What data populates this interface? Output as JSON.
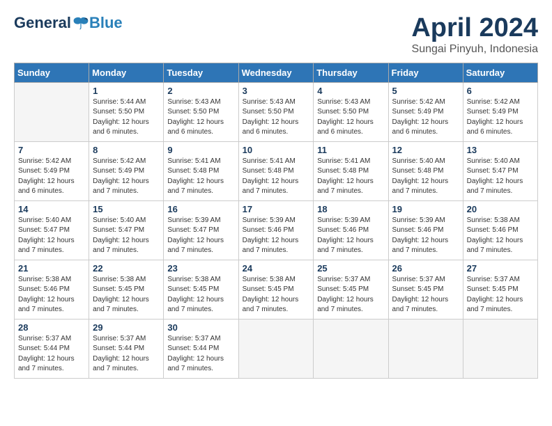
{
  "header": {
    "logo_general": "General",
    "logo_blue": "Blue",
    "month": "April 2024",
    "location": "Sungai Pinyuh, Indonesia"
  },
  "weekdays": [
    "Sunday",
    "Monday",
    "Tuesday",
    "Wednesday",
    "Thursday",
    "Friday",
    "Saturday"
  ],
  "weeks": [
    [
      {
        "day": "",
        "info": ""
      },
      {
        "day": "1",
        "info": "Sunrise: 5:44 AM\nSunset: 5:50 PM\nDaylight: 12 hours\nand 6 minutes."
      },
      {
        "day": "2",
        "info": "Sunrise: 5:43 AM\nSunset: 5:50 PM\nDaylight: 12 hours\nand 6 minutes."
      },
      {
        "day": "3",
        "info": "Sunrise: 5:43 AM\nSunset: 5:50 PM\nDaylight: 12 hours\nand 6 minutes."
      },
      {
        "day": "4",
        "info": "Sunrise: 5:43 AM\nSunset: 5:50 PM\nDaylight: 12 hours\nand 6 minutes."
      },
      {
        "day": "5",
        "info": "Sunrise: 5:42 AM\nSunset: 5:49 PM\nDaylight: 12 hours\nand 6 minutes."
      },
      {
        "day": "6",
        "info": "Sunrise: 5:42 AM\nSunset: 5:49 PM\nDaylight: 12 hours\nand 6 minutes."
      }
    ],
    [
      {
        "day": "7",
        "info": "Sunrise: 5:42 AM\nSunset: 5:49 PM\nDaylight: 12 hours\nand 6 minutes."
      },
      {
        "day": "8",
        "info": "Sunrise: 5:42 AM\nSunset: 5:49 PM\nDaylight: 12 hours\nand 7 minutes."
      },
      {
        "day": "9",
        "info": "Sunrise: 5:41 AM\nSunset: 5:48 PM\nDaylight: 12 hours\nand 7 minutes."
      },
      {
        "day": "10",
        "info": "Sunrise: 5:41 AM\nSunset: 5:48 PM\nDaylight: 12 hours\nand 7 minutes."
      },
      {
        "day": "11",
        "info": "Sunrise: 5:41 AM\nSunset: 5:48 PM\nDaylight: 12 hours\nand 7 minutes."
      },
      {
        "day": "12",
        "info": "Sunrise: 5:40 AM\nSunset: 5:48 PM\nDaylight: 12 hours\nand 7 minutes."
      },
      {
        "day": "13",
        "info": "Sunrise: 5:40 AM\nSunset: 5:47 PM\nDaylight: 12 hours\nand 7 minutes."
      }
    ],
    [
      {
        "day": "14",
        "info": "Sunrise: 5:40 AM\nSunset: 5:47 PM\nDaylight: 12 hours\nand 7 minutes."
      },
      {
        "day": "15",
        "info": "Sunrise: 5:40 AM\nSunset: 5:47 PM\nDaylight: 12 hours\nand 7 minutes."
      },
      {
        "day": "16",
        "info": "Sunrise: 5:39 AM\nSunset: 5:47 PM\nDaylight: 12 hours\nand 7 minutes."
      },
      {
        "day": "17",
        "info": "Sunrise: 5:39 AM\nSunset: 5:46 PM\nDaylight: 12 hours\nand 7 minutes."
      },
      {
        "day": "18",
        "info": "Sunrise: 5:39 AM\nSunset: 5:46 PM\nDaylight: 12 hours\nand 7 minutes."
      },
      {
        "day": "19",
        "info": "Sunrise: 5:39 AM\nSunset: 5:46 PM\nDaylight: 12 hours\nand 7 minutes."
      },
      {
        "day": "20",
        "info": "Sunrise: 5:38 AM\nSunset: 5:46 PM\nDaylight: 12 hours\nand 7 minutes."
      }
    ],
    [
      {
        "day": "21",
        "info": "Sunrise: 5:38 AM\nSunset: 5:46 PM\nDaylight: 12 hours\nand 7 minutes."
      },
      {
        "day": "22",
        "info": "Sunrise: 5:38 AM\nSunset: 5:45 PM\nDaylight: 12 hours\nand 7 minutes."
      },
      {
        "day": "23",
        "info": "Sunrise: 5:38 AM\nSunset: 5:45 PM\nDaylight: 12 hours\nand 7 minutes."
      },
      {
        "day": "24",
        "info": "Sunrise: 5:38 AM\nSunset: 5:45 PM\nDaylight: 12 hours\nand 7 minutes."
      },
      {
        "day": "25",
        "info": "Sunrise: 5:37 AM\nSunset: 5:45 PM\nDaylight: 12 hours\nand 7 minutes."
      },
      {
        "day": "26",
        "info": "Sunrise: 5:37 AM\nSunset: 5:45 PM\nDaylight: 12 hours\nand 7 minutes."
      },
      {
        "day": "27",
        "info": "Sunrise: 5:37 AM\nSunset: 5:45 PM\nDaylight: 12 hours\nand 7 minutes."
      }
    ],
    [
      {
        "day": "28",
        "info": "Sunrise: 5:37 AM\nSunset: 5:44 PM\nDaylight: 12 hours\nand 7 minutes."
      },
      {
        "day": "29",
        "info": "Sunrise: 5:37 AM\nSunset: 5:44 PM\nDaylight: 12 hours\nand 7 minutes."
      },
      {
        "day": "30",
        "info": "Sunrise: 5:37 AM\nSunset: 5:44 PM\nDaylight: 12 hours\nand 7 minutes."
      },
      {
        "day": "",
        "info": ""
      },
      {
        "day": "",
        "info": ""
      },
      {
        "day": "",
        "info": ""
      },
      {
        "day": "",
        "info": ""
      }
    ]
  ]
}
